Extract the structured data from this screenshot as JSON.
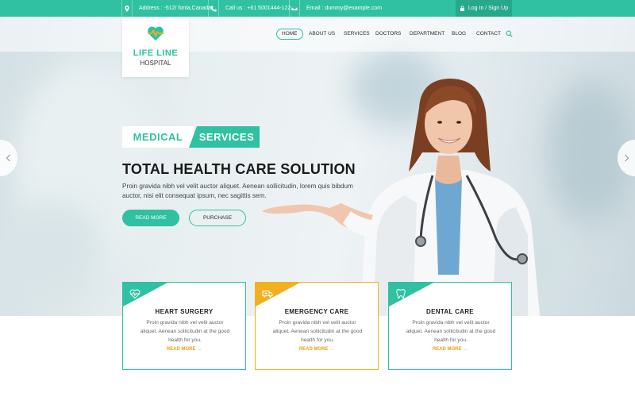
{
  "topbar": {
    "address": "Address : -512/ fonla,Canada",
    "phone": "Call us : +61 5001444-122",
    "email": "Email : dummy@example.com",
    "login": "Log In / Sign Up"
  },
  "logo": {
    "line1": "LIFE LINE",
    "line2": "HOSPITAL"
  },
  "nav": {
    "home": "HOME",
    "about": "ABOUT US",
    "services": "SERVICES",
    "doctors": "DOCTORS",
    "department": "DEPARTMENT",
    "blog": "BLOG",
    "contact": "CONTACT"
  },
  "hero": {
    "tag1": "MEDICAL",
    "tag2": "SERVICES",
    "headline": "TOTAL HEALTH CARE SOLUTION",
    "subtext": "Proin gravida nibh vel velit auctor aliquet. Aenean sollicitudin, lorem quis bibdum auctor, nisi elit consequat ipsum, nec sagittis sem.",
    "read_more": "READ MORE",
    "purchase": "PURCHASE"
  },
  "cards": [
    {
      "title": "HEART SURGERY",
      "desc": "Proin gravida nibh vel velit auctor aliquet. Aenean sollicitudin at the good health for you.",
      "more": "READ MORE →",
      "accent": "#2fc1a1",
      "icon": "heartbeat-icon"
    },
    {
      "title": "EMERGENCY CARE",
      "desc": "Proin gravida nibh vel velit auctor aliquet. Aenean sollicitudin at the good health for you.",
      "more": "READ MORE →",
      "accent": "#f2b01e",
      "icon": "ambulance-icon"
    },
    {
      "title": "DENTAL CARE",
      "desc": "Proin gravida nibh vel velit auctor aliquet. Aenean sollicitudin at the good health for you.",
      "more": "READ MORE →",
      "accent": "#2fc1a1",
      "icon": "tooth-icon"
    }
  ],
  "colors": {
    "accent": "#2fc1a1",
    "accent_dark": "#26a88c",
    "warm": "#f2b01e"
  }
}
